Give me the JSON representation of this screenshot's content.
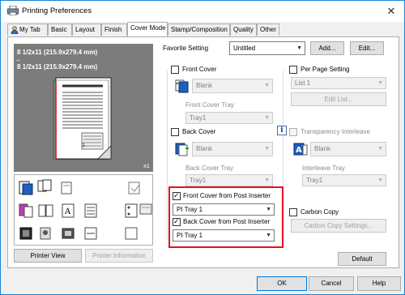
{
  "window": {
    "title": "Printing Preferences",
    "close_glyph": "✕"
  },
  "tabs": [
    "My Tab",
    "Basic",
    "Layout",
    "Finish",
    "Cover Mode",
    "Stamp/Composition",
    "Quality",
    "Other"
  ],
  "active_tab": "Cover Mode",
  "preview": {
    "paper_line1": "8 1/2x11 (215.9x279.4 mm)",
    "paper_line2": "8 1/2x11 (215.9x279.4 mm)",
    "arrow": "→",
    "page_number": "1",
    "copies": "x1",
    "printer_view_button": "Printer View",
    "printer_information_button": "Printer Information"
  },
  "favorite": {
    "label": "Favorite Setting",
    "value": "Untitled",
    "add_button": "Add...",
    "edit_button": "Edit..."
  },
  "front_cover": {
    "label": "Front Cover",
    "checked": false,
    "type_value": "Blank",
    "tray_label": "Front Cover Tray",
    "tray_value": "Tray1"
  },
  "back_cover": {
    "label": "Back Cover",
    "checked": false,
    "type_value": "Blank",
    "tray_label": "Back Cover Tray",
    "tray_value": "Tray1"
  },
  "post_inserter": {
    "front_label": "Front Cover from Post Inserter",
    "front_checked": true,
    "front_tray": "PI Tray 1",
    "back_label": "Back Cover from Post Inserter",
    "back_checked": true,
    "back_tray": "PI Tray 1"
  },
  "per_page": {
    "label": "Per Page Setting",
    "checked": false,
    "list_value": "List 1",
    "edit_list_button": "Edit List..."
  },
  "transparency": {
    "label": "Transparency Interleave",
    "checked": false,
    "type_value": "Blank",
    "tray_label": "Interleave Tray",
    "tray_value": "Tray1",
    "info_glyph": "i"
  },
  "carbon": {
    "label": "Carbon Copy",
    "checked": false,
    "settings_button": "Carbon Copy Settings..."
  },
  "buttons": {
    "default": "Default",
    "ok": "OK",
    "cancel": "Cancel",
    "help": "Help"
  },
  "colors": {
    "highlight": "#e8101e",
    "preview_bg": "#7c7c7c",
    "focus": "#0078d7"
  }
}
